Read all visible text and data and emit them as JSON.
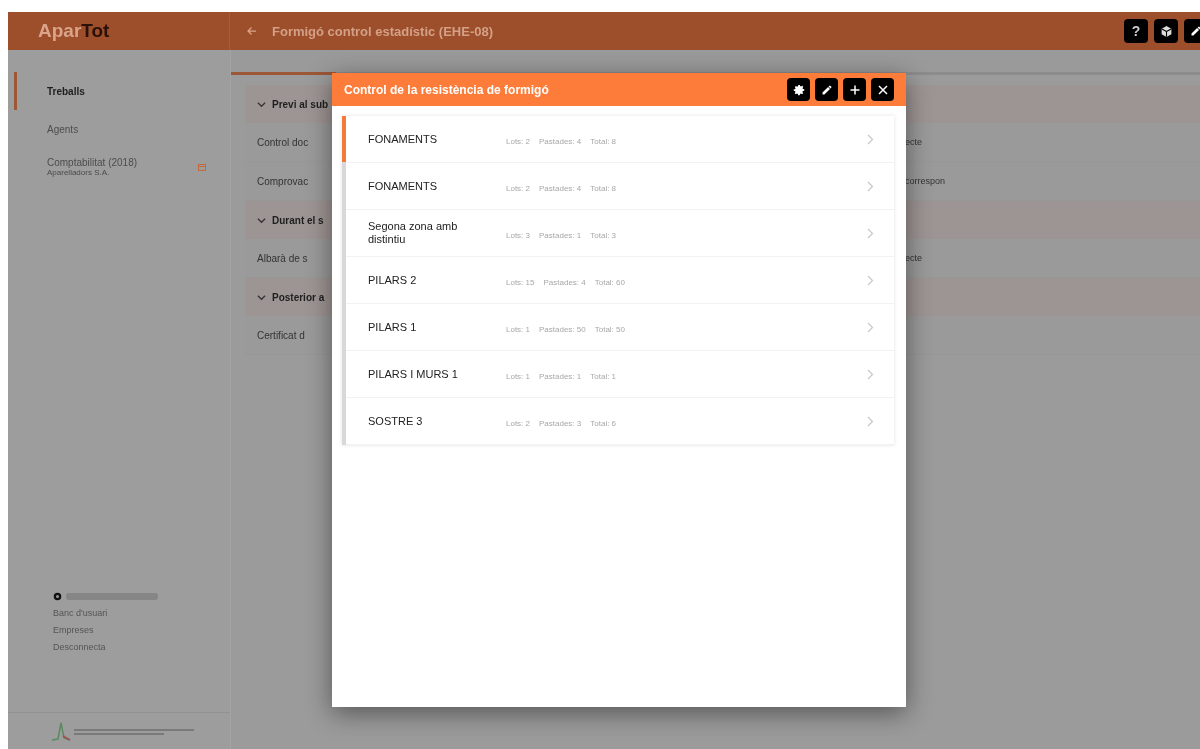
{
  "header": {
    "logo": {
      "part1": "Apar",
      "part2": "Tot"
    },
    "title": "Formigó control estadístic (EHE-08)",
    "actions": [
      {
        "kind": "help",
        "label": "?"
      },
      {
        "kind": "cube"
      },
      {
        "kind": "edit"
      }
    ]
  },
  "sidebar": {
    "items": [
      {
        "label": "Treballs",
        "selected": true
      },
      {
        "label": "Agents",
        "selected": false
      },
      {
        "label": "Comptabilitat (2018)",
        "subtitle": "Aparelladors S.A.",
        "selected": false,
        "badge": true
      }
    ],
    "user_links": [
      "Banc d'usuari",
      "Empreses",
      "Desconnecta"
    ]
  },
  "sections": [
    {
      "title": "Previ al sub",
      "expanded": true,
      "items": [
        {
          "label": "Control doc",
          "tail": "ecte"
        },
        {
          "label": "Comprovac",
          "tail": "correspon"
        }
      ]
    },
    {
      "title": "Durant el s",
      "expanded": true,
      "items": [
        {
          "label": "Albarà de s",
          "tail": "ecte"
        }
      ]
    },
    {
      "title": "Posterior a",
      "expanded": true,
      "items": [
        {
          "label": "Certificat d"
        }
      ]
    }
  ],
  "dialog": {
    "title": "Control de la resistència de formigó",
    "actions": [
      {
        "kind": "settings"
      },
      {
        "kind": "edit"
      },
      {
        "kind": "add"
      },
      {
        "kind": "close"
      }
    ],
    "items": [
      {
        "name": "FONAMENTS",
        "lots": "Lots: 2",
        "pastades": "Pastades: 4",
        "total": "Total: 8",
        "selected": true
      },
      {
        "name": "FONAMENTS",
        "lots": "Lots: 2",
        "pastades": "Pastades: 4",
        "total": "Total: 8",
        "selected": false
      },
      {
        "name": "Segona zona amb distintiu",
        "lots": "Lots: 3",
        "pastades": "Pastades: 1",
        "total": "Total: 3",
        "selected": false
      },
      {
        "name": "PILARS 2",
        "lots": "Lots: 15",
        "pastades": "Pastades: 4",
        "total": "Total: 60",
        "selected": false
      },
      {
        "name": "PILARS 1",
        "lots": "Lots: 1",
        "pastades": "Pastades: 50",
        "total": "Total: 50",
        "selected": false
      },
      {
        "name": "PILARS I MURS 1",
        "lots": "Lots: 1",
        "pastades": "Pastades: 1",
        "total": "Total: 1",
        "selected": false
      },
      {
        "name": "SOSTRE 3",
        "lots": "Lots: 2",
        "pastades": "Pastades: 3",
        "total": "Total: 6",
        "selected": false
      }
    ]
  }
}
